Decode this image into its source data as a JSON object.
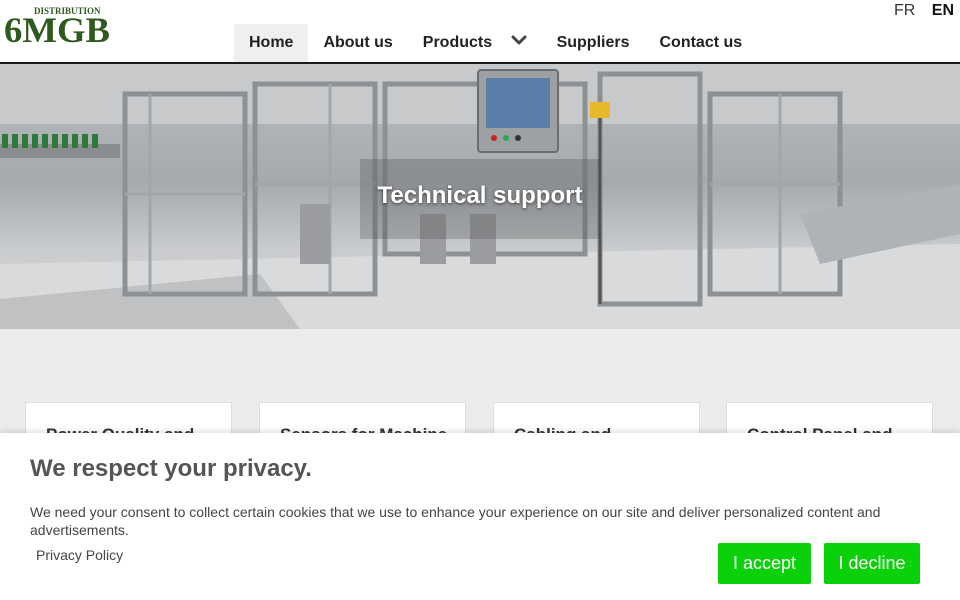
{
  "logo": {
    "top_text": "DISTRIBUTION",
    "main_text": "6MGB",
    "color": "#2e5a1e"
  },
  "language": {
    "options": [
      "FR",
      "EN"
    ],
    "selected": "EN"
  },
  "nav": {
    "items": [
      {
        "label": "Home",
        "active": true
      },
      {
        "label": "About us"
      },
      {
        "label": "Products",
        "has_dropdown": true
      },
      {
        "label": "Suppliers"
      },
      {
        "label": "Contact us"
      }
    ]
  },
  "hero": {
    "title": "Technical support"
  },
  "cards": [
    {
      "title": "Power Quality and"
    },
    {
      "title": "Sensors for Machine"
    },
    {
      "title": "Cabling and"
    },
    {
      "title": "Control Panel and"
    }
  ],
  "cookie": {
    "heading": "We respect your privacy.",
    "message": "We need your consent to collect certain cookies that we use to enhance your experience on our site and deliver personalized content and advertisements.",
    "policy_link": "Privacy Policy",
    "accept_label": "I accept",
    "decline_label": "I decline",
    "button_color": "#0bd10b"
  }
}
